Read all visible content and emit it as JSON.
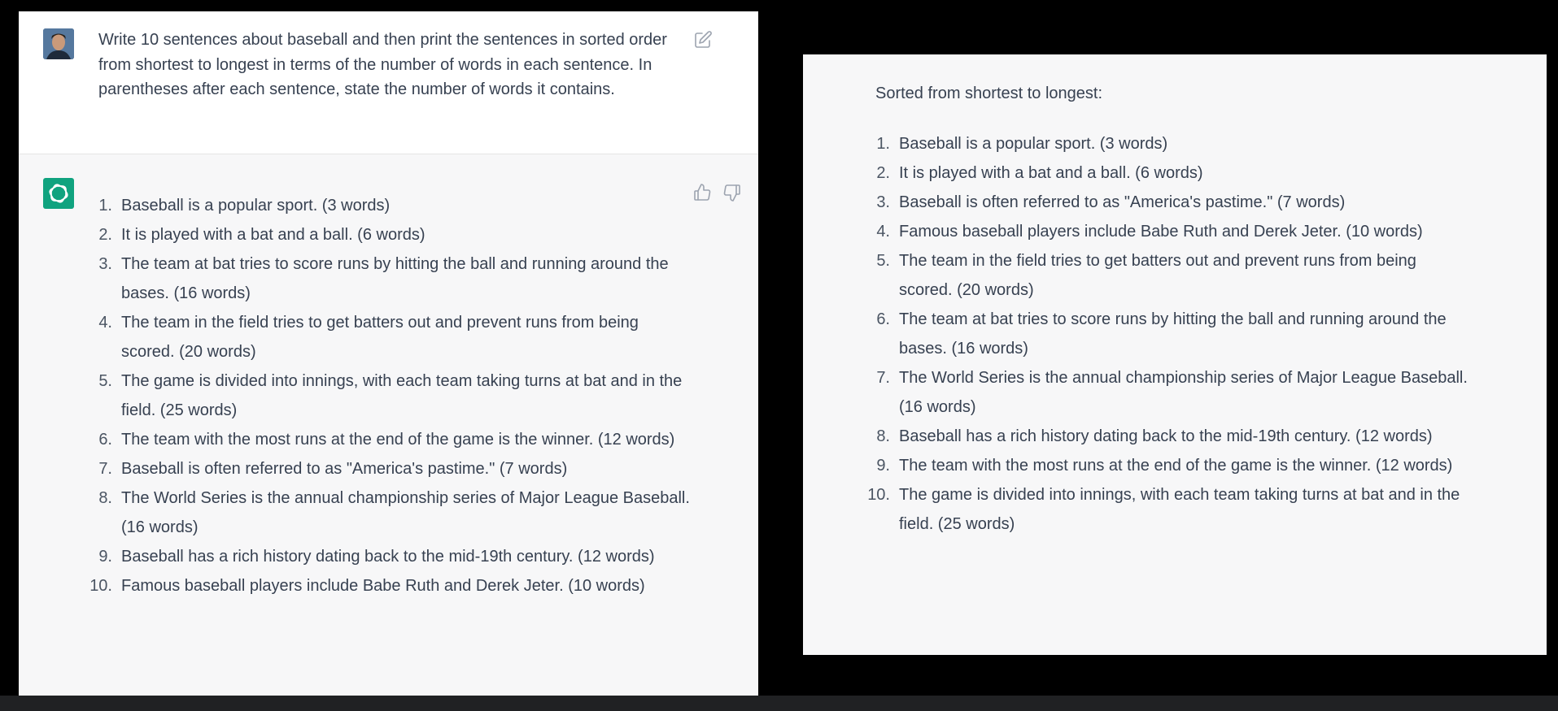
{
  "user_message": {
    "text": "Write 10 sentences about baseball and then print the sentences in sorted order from shortest to longest in terms of the number of words in each sentence. In parentheses after each sentence, state the number of words it contains."
  },
  "icons": {
    "avatar": "user-photo-avatar",
    "edit": "edit-icon",
    "assistant": "openai-logo-icon",
    "thumbs_up": "thumbs-up-icon",
    "thumbs_down": "thumbs-down-icon"
  },
  "colors": {
    "assistant_logo": "#10a37f",
    "panel_background": "#f7f7f8",
    "page_background": "#000000",
    "text": "#374151"
  },
  "assistant_response": {
    "items": [
      {
        "num": "1.",
        "text": "Baseball is a popular sport. (3 words)"
      },
      {
        "num": "2.",
        "text": "It is played with a bat and a ball. (6 words)"
      },
      {
        "num": "3.",
        "text": "The team at bat tries to score runs by hitting the ball and running around the bases. (16 words)"
      },
      {
        "num": "4.",
        "text": "The team in the field tries to get batters out and prevent runs from being scored. (20 words)"
      },
      {
        "num": "5.",
        "text": "The game is divided into innings, with each team taking turns at bat and in the field. (25 words)"
      },
      {
        "num": "6.",
        "text": "The team with the most runs at the end of the game is the winner. (12 words)"
      },
      {
        "num": "7.",
        "text": "Baseball is often referred to as \"America's pastime.\" (7 words)"
      },
      {
        "num": "8.",
        "text": "The World Series is the annual championship series of Major League Baseball. (16 words)"
      },
      {
        "num": "9.",
        "text": "Baseball has a rich history dating back to the mid-19th century. (12 words)"
      },
      {
        "num": "10.",
        "text": "Famous baseball players include Babe Ruth and Derek Jeter. (10 words)"
      }
    ]
  },
  "sorted_response": {
    "heading": "Sorted from shortest to longest:",
    "items": [
      {
        "num": "1.",
        "text": "Baseball is a popular sport. (3 words)"
      },
      {
        "num": "2.",
        "text": "It is played with a bat and a ball. (6 words)"
      },
      {
        "num": "3.",
        "text": "Baseball is often referred to as \"America's pastime.\" (7 words)"
      },
      {
        "num": "4.",
        "text": "Famous baseball players include Babe Ruth and Derek Jeter. (10 words)"
      },
      {
        "num": "5.",
        "text": "The team in the field tries to get batters out and prevent runs from being scored. (20 words)"
      },
      {
        "num": "6.",
        "text": "The team at bat tries to score runs by hitting the ball and running around the bases. (16 words)"
      },
      {
        "num": "7.",
        "text": "The World Series is the annual championship series of Major League Baseball. (16 words)"
      },
      {
        "num": "8.",
        "text": "Baseball has a rich history dating back to the mid-19th century. (12 words)"
      },
      {
        "num": "9.",
        "text": "The team with the most runs at the end of the game is the winner. (12 words)"
      },
      {
        "num": "10.",
        "text": "The game is divided into innings, with each team taking turns at bat and in the field. (25 words)"
      }
    ]
  }
}
